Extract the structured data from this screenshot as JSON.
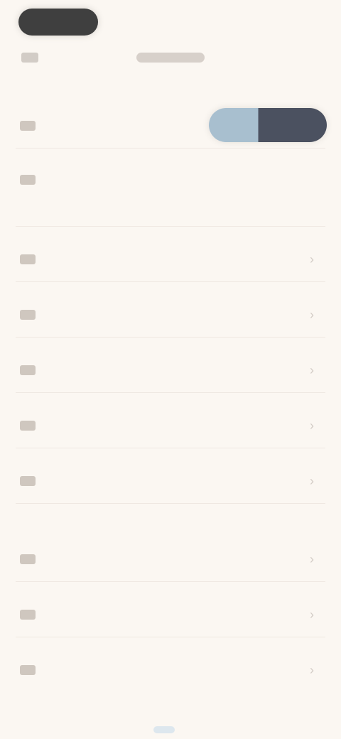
{
  "window": {
    "title": ""
  },
  "header": {
    "title": ""
  },
  "menu": {
    "items": [
      {
        "label": "",
        "has_chevron": false
      },
      {
        "label": "",
        "has_chevron": false
      },
      {
        "label": "",
        "has_chevron": true
      },
      {
        "label": "",
        "has_chevron": true
      },
      {
        "label": "",
        "has_chevron": true
      },
      {
        "label": "",
        "has_chevron": true
      },
      {
        "label": "",
        "has_chevron": true
      },
      {
        "label": "",
        "has_chevron": true
      },
      {
        "label": "",
        "has_chevron": true
      },
      {
        "label": "",
        "has_chevron": true
      }
    ]
  },
  "toggle": {
    "options": [
      "",
      ""
    ],
    "selected_index": 1
  },
  "colors": {
    "background": "#fbf7f2",
    "toggle_left": "#a8bfcf",
    "toggle_right": "#4b5160",
    "logo": "#3f3f3f"
  },
  "icons": {
    "menu_icon": "menu-item-icon",
    "chevron": "chevron-right-icon"
  }
}
